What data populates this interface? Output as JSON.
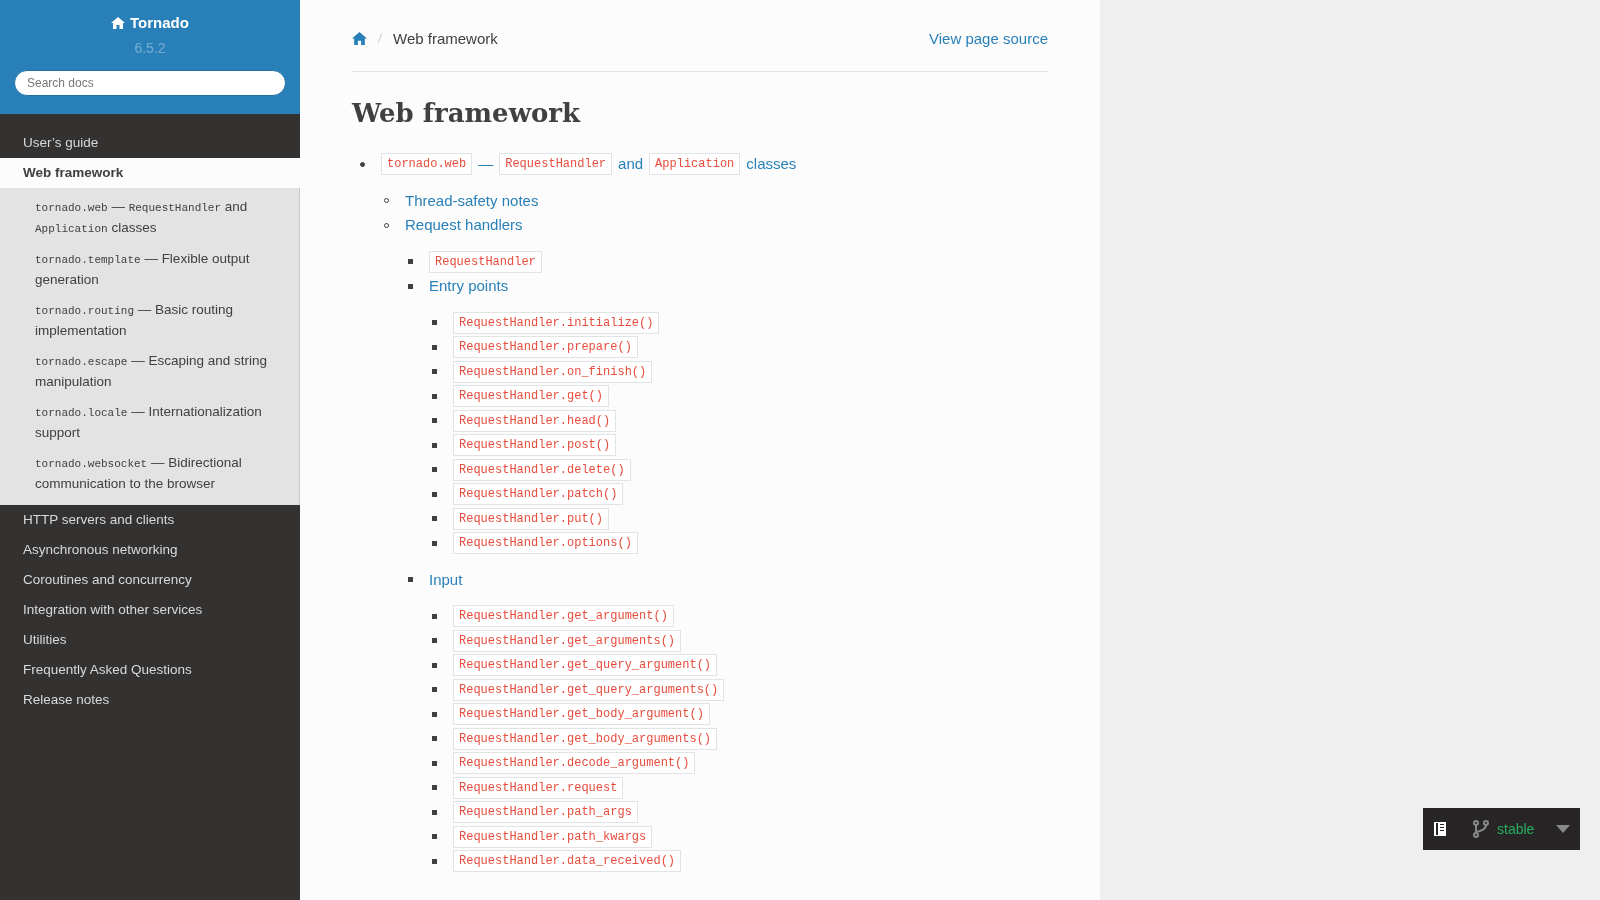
{
  "sidebar": {
    "project": "Tornado",
    "version": "6.5.2",
    "search": {
      "placeholder": "Search docs"
    },
    "nav": [
      {
        "label": "User’s guide",
        "selected": false
      },
      {
        "label": "Web framework",
        "selected": true,
        "children": [
          {
            "parts": [
              {
                "kind": "code",
                "text": "tornado.web"
              },
              {
                "kind": "text",
                "text": " — "
              },
              {
                "kind": "code",
                "text": "RequestHandler"
              },
              {
                "kind": "text",
                "text": " and "
              },
              {
                "kind": "code",
                "text": "Application"
              },
              {
                "kind": "text",
                "text": " classes"
              }
            ]
          },
          {
            "parts": [
              {
                "kind": "code",
                "text": "tornado.template"
              },
              {
                "kind": "text",
                "text": " — Flexible output generation"
              }
            ]
          },
          {
            "parts": [
              {
                "kind": "code",
                "text": "tornado.routing"
              },
              {
                "kind": "text",
                "text": " — Basic routing implementation"
              }
            ]
          },
          {
            "parts": [
              {
                "kind": "code",
                "text": "tornado.escape"
              },
              {
                "kind": "text",
                "text": " — Escaping and string manipulation"
              }
            ]
          },
          {
            "parts": [
              {
                "kind": "code",
                "text": "tornado.locale"
              },
              {
                "kind": "text",
                "text": " — Internationalization support"
              }
            ]
          },
          {
            "parts": [
              {
                "kind": "code",
                "text": "tornado.websocket"
              },
              {
                "kind": "text",
                "text": " — Bidirectional communication to the browser"
              }
            ]
          }
        ]
      },
      {
        "label": "HTTP servers and clients",
        "selected": false
      },
      {
        "label": "Asynchronous networking",
        "selected": false
      },
      {
        "label": "Coroutines and concurrency",
        "selected": false
      },
      {
        "label": "Integration with other services",
        "selected": false
      },
      {
        "label": "Utilities",
        "selected": false
      },
      {
        "label": "Frequently Asked Questions",
        "selected": false
      },
      {
        "label": "Release notes",
        "selected": false
      }
    ]
  },
  "breadcrumb": {
    "current": "Web framework",
    "source_link": "View page source"
  },
  "title": "Web framework",
  "toc": [
    {
      "kind": "parts",
      "parts": [
        {
          "kind": "code",
          "text": "tornado.web"
        },
        {
          "kind": "text",
          "text": "—"
        },
        {
          "kind": "code",
          "text": "RequestHandler"
        },
        {
          "kind": "text",
          "text": "and"
        },
        {
          "kind": "code",
          "text": "Application"
        },
        {
          "kind": "text",
          "text": "classes"
        }
      ],
      "children": [
        {
          "kind": "link",
          "text": "Thread-safety notes"
        },
        {
          "kind": "link",
          "text": "Request handlers",
          "children": [
            {
              "kind": "code",
              "text": "RequestHandler"
            },
            {
              "kind": "link",
              "text": "Entry points",
              "children": [
                {
                  "kind": "code",
                  "text": "RequestHandler.initialize()"
                },
                {
                  "kind": "code",
                  "text": "RequestHandler.prepare()"
                },
                {
                  "kind": "code",
                  "text": "RequestHandler.on_finish()"
                },
                {
                  "kind": "code",
                  "text": "RequestHandler.get()"
                },
                {
                  "kind": "code",
                  "text": "RequestHandler.head()"
                },
                {
                  "kind": "code",
                  "text": "RequestHandler.post()"
                },
                {
                  "kind": "code",
                  "text": "RequestHandler.delete()"
                },
                {
                  "kind": "code",
                  "text": "RequestHandler.patch()"
                },
                {
                  "kind": "code",
                  "text": "RequestHandler.put()"
                },
                {
                  "kind": "code",
                  "text": "RequestHandler.options()"
                }
              ]
            },
            {
              "kind": "link",
              "text": "Input",
              "children": [
                {
                  "kind": "code",
                  "text": "RequestHandler.get_argument()"
                },
                {
                  "kind": "code",
                  "text": "RequestHandler.get_arguments()"
                },
                {
                  "kind": "code",
                  "text": "RequestHandler.get_query_argument()"
                },
                {
                  "kind": "code",
                  "text": "RequestHandler.get_query_arguments()"
                },
                {
                  "kind": "code",
                  "text": "RequestHandler.get_body_argument()"
                },
                {
                  "kind": "code",
                  "text": "RequestHandler.get_body_arguments()"
                },
                {
                  "kind": "code",
                  "text": "RequestHandler.decode_argument()"
                },
                {
                  "kind": "code",
                  "text": "RequestHandler.request"
                },
                {
                  "kind": "code",
                  "text": "RequestHandler.path_args"
                },
                {
                  "kind": "code",
                  "text": "RequestHandler.path_kwargs"
                },
                {
                  "kind": "code",
                  "text": "RequestHandler.data_received()"
                }
              ]
            }
          ]
        }
      ]
    }
  ],
  "version_badge": {
    "branch": "stable"
  }
}
